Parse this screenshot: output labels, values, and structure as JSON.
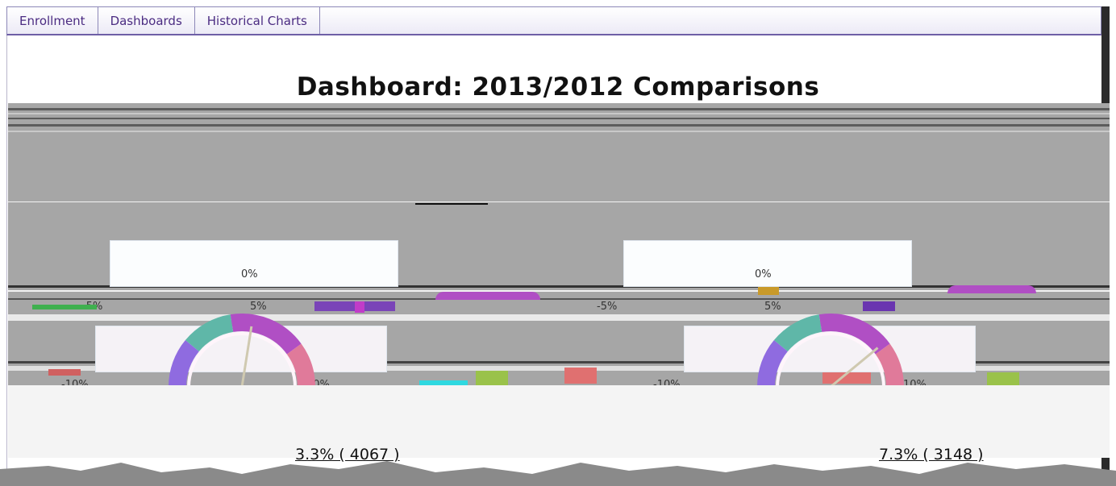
{
  "nav": {
    "tabs": [
      {
        "label": "Enrollment"
      },
      {
        "label": "Dashboards"
      },
      {
        "label": "Historical Charts"
      }
    ]
  },
  "page": {
    "title": "Dashboard: 2013/2012 Comparisons"
  },
  "gauges": [
    {
      "panel_value": "0%",
      "scale_labels": {
        "left": "-5%",
        "mid": "5%",
        "low_left": "-10%",
        "low_right": "10%"
      },
      "summary": "3.3% ( 4067 )",
      "needle_fraction": 0.55
    },
    {
      "panel_value": "0%",
      "scale_labels": {
        "left": "-5%",
        "mid": "5%",
        "low_left": "-10%",
        "low_right": "10%"
      },
      "summary": "7.3% ( 3148 )",
      "needle_fraction": 0.78
    }
  ],
  "colors": {
    "tab_text": "#4b2c82",
    "tab_border": "#8d88b8",
    "gauge_purple": "#b04fc4",
    "gauge_violet": "#8f6be0",
    "gauge_teal": "#5fb7a8",
    "gauge_pink": "#e07a9a",
    "gray_bg": "#a6a6a6"
  }
}
